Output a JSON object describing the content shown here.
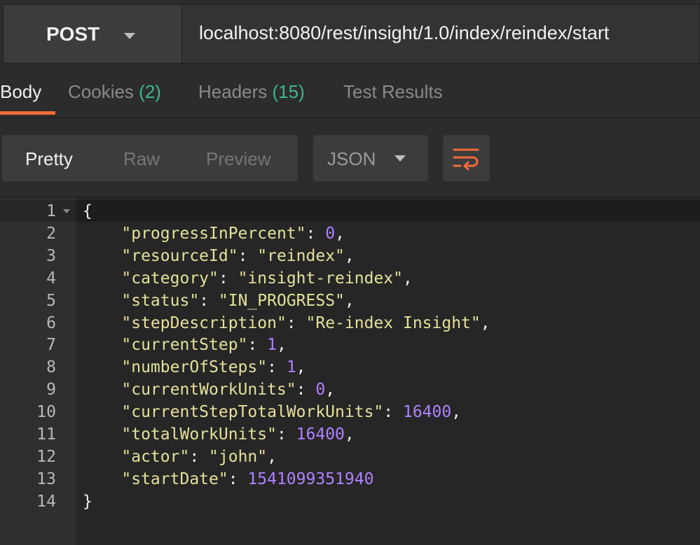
{
  "request": {
    "method": "POST",
    "url": "localhost:8080/rest/insight/1.0/index/reindex/start"
  },
  "response_tabs": [
    {
      "label": "Body",
      "count": ""
    },
    {
      "label": "Cookies",
      "count": "(2)"
    },
    {
      "label": "Headers",
      "count": "(15)"
    },
    {
      "label": "Test Results",
      "count": ""
    }
  ],
  "view_modes": [
    "Pretty",
    "Raw",
    "Preview"
  ],
  "format": "JSON",
  "icons": {
    "wrap": "wrap-lines-icon",
    "method_dropdown": "chevron-down-icon"
  },
  "colors": {
    "accent": "#f26b3a",
    "count": "#3fb68f",
    "json_key": "#e5e09a",
    "json_number": "#ae81ff"
  },
  "code": {
    "line_numbers": [
      "1",
      "2",
      "3",
      "4",
      "5",
      "6",
      "7",
      "8",
      "9",
      "10",
      "11",
      "12",
      "13",
      "14"
    ],
    "open_brace": "{",
    "close_brace": "}",
    "entries": [
      {
        "key": "\"progressInPercent\"",
        "value": "0",
        "type": "number",
        "comma": ","
      },
      {
        "key": "\"resourceId\"",
        "value": "\"reindex\"",
        "type": "string",
        "comma": ","
      },
      {
        "key": "\"category\"",
        "value": "\"insight-reindex\"",
        "type": "string",
        "comma": ","
      },
      {
        "key": "\"status\"",
        "value": "\"IN_PROGRESS\"",
        "type": "string",
        "comma": ","
      },
      {
        "key": "\"stepDescription\"",
        "value": "\"Re-index Insight\"",
        "type": "string",
        "comma": ","
      },
      {
        "key": "\"currentStep\"",
        "value": "1",
        "type": "number",
        "comma": ","
      },
      {
        "key": "\"numberOfSteps\"",
        "value": "1",
        "type": "number",
        "comma": ","
      },
      {
        "key": "\"currentWorkUnits\"",
        "value": "0",
        "type": "number",
        "comma": ","
      },
      {
        "key": "\"currentStepTotalWorkUnits\"",
        "value": "16400",
        "type": "number",
        "comma": ","
      },
      {
        "key": "\"totalWorkUnits\"",
        "value": "16400",
        "type": "number",
        "comma": ","
      },
      {
        "key": "\"actor\"",
        "value": "\"john\"",
        "type": "string",
        "comma": ","
      },
      {
        "key": "\"startDate\"",
        "value": "1541099351940",
        "type": "number",
        "comma": ""
      }
    ]
  }
}
